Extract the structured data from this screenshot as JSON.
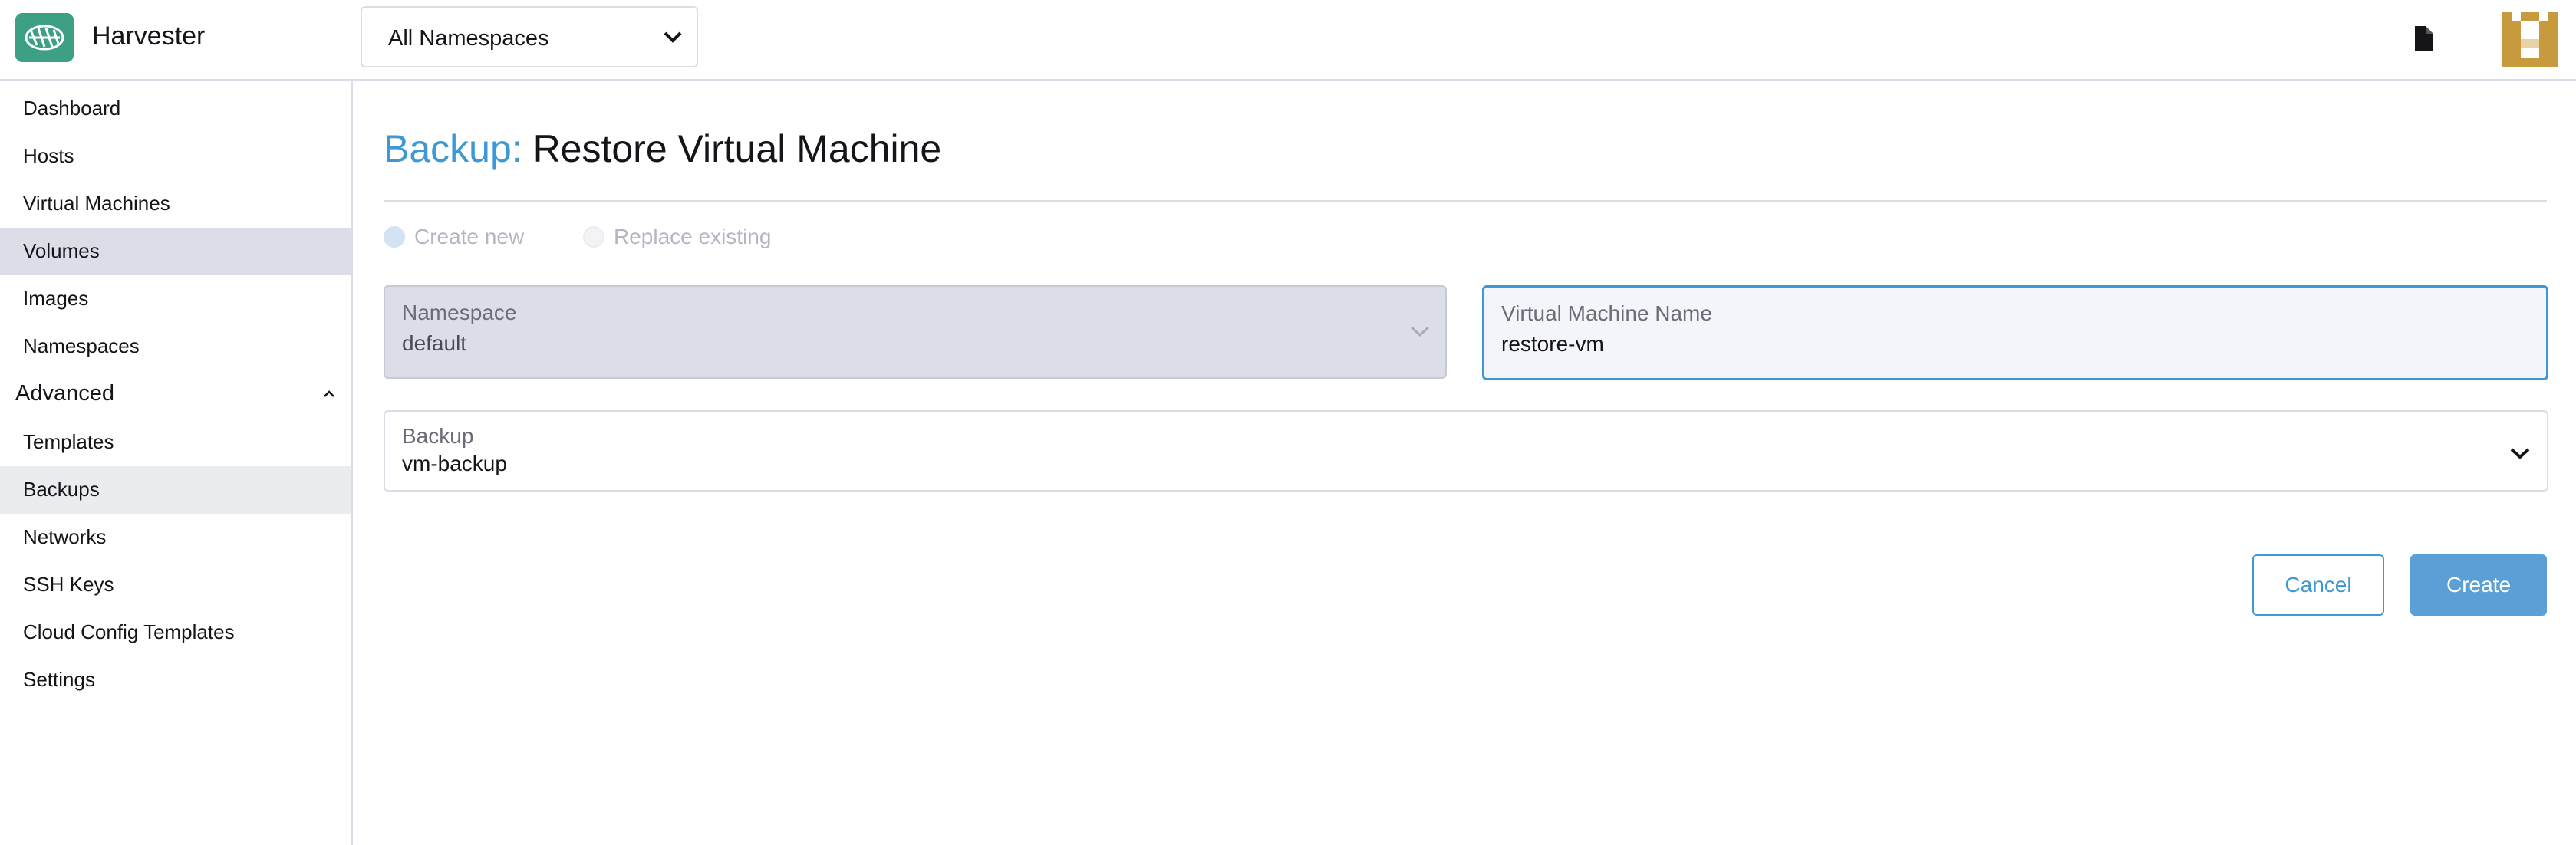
{
  "header": {
    "app_name": "Harvester",
    "namespace_select": "All Namespaces",
    "logo_icon": "harvester-logo-icon",
    "doc_icon": "document-icon",
    "avatar_icon": "user-avatar-icon"
  },
  "sidebar": {
    "items": [
      {
        "label": "Dashboard"
      },
      {
        "label": "Hosts"
      },
      {
        "label": "Virtual Machines"
      },
      {
        "label": "Volumes"
      },
      {
        "label": "Images"
      },
      {
        "label": "Namespaces"
      }
    ],
    "group": {
      "label": "Advanced"
    },
    "advanced_items": [
      {
        "label": "Templates"
      },
      {
        "label": "Backups"
      },
      {
        "label": "Networks"
      },
      {
        "label": "SSH Keys"
      },
      {
        "label": "Cloud Config Templates"
      },
      {
        "label": "Settings"
      }
    ]
  },
  "main": {
    "title_prefix": "Backup:",
    "title_rest": " Restore Virtual Machine",
    "radio_create": "Create new",
    "radio_replace": "Replace existing",
    "namespace": {
      "label": "Namespace",
      "value": "default"
    },
    "vm_name": {
      "label": "Virtual Machine Name",
      "value": "restore-vm"
    },
    "backup": {
      "label": "Backup",
      "value": "vm-backup"
    },
    "cancel_label": "Cancel",
    "create_label": "Create"
  },
  "colors": {
    "accent": "#3d98d3",
    "brand": "#3d9f83",
    "active_nav": "#dcdee7"
  }
}
